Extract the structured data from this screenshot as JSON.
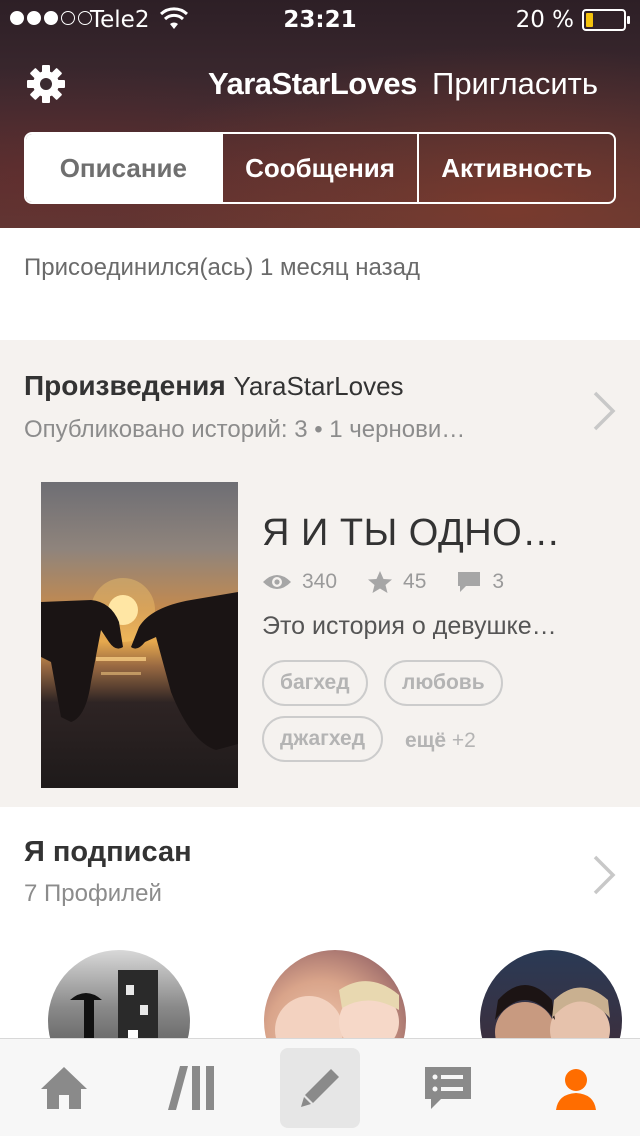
{
  "status_bar": {
    "carrier": "Tele2",
    "time": "23:21",
    "battery": "20 %",
    "battery_level": 0.2
  },
  "header": {
    "title": "YaraStarLoves",
    "invite_label": "Пригласить"
  },
  "tabs": [
    {
      "label": "Описание",
      "active": true
    },
    {
      "label": "Сообщения",
      "active": false
    },
    {
      "label": "Активность",
      "active": false
    }
  ],
  "about": {
    "joined": "Присоединился(ась) 1 месяц назад"
  },
  "works": {
    "title": "Произведения",
    "username": "YaraStarLoves",
    "subtitle": "Опубликовано историй: 3 • 1 чернови…",
    "story": {
      "title": "Я И ТЫ ОДНО…",
      "views": "340",
      "votes": "45",
      "comments": "3",
      "description": "Это история о девушке…",
      "tags": [
        "багхед",
        "любовь",
        "джагхед"
      ],
      "more_tags": "ещё",
      "more_count": "+2"
    }
  },
  "following": {
    "title": "Я подписан",
    "subtitle": "7 Профилей"
  },
  "tab_bar": {
    "items": [
      {
        "icon": "home-icon"
      },
      {
        "icon": "library-icon"
      },
      {
        "icon": "pencil-icon"
      },
      {
        "icon": "messages-icon"
      },
      {
        "icon": "profile-icon"
      }
    ],
    "active_color": "#ff6d00",
    "inactive_color": "#8a8a8a"
  }
}
